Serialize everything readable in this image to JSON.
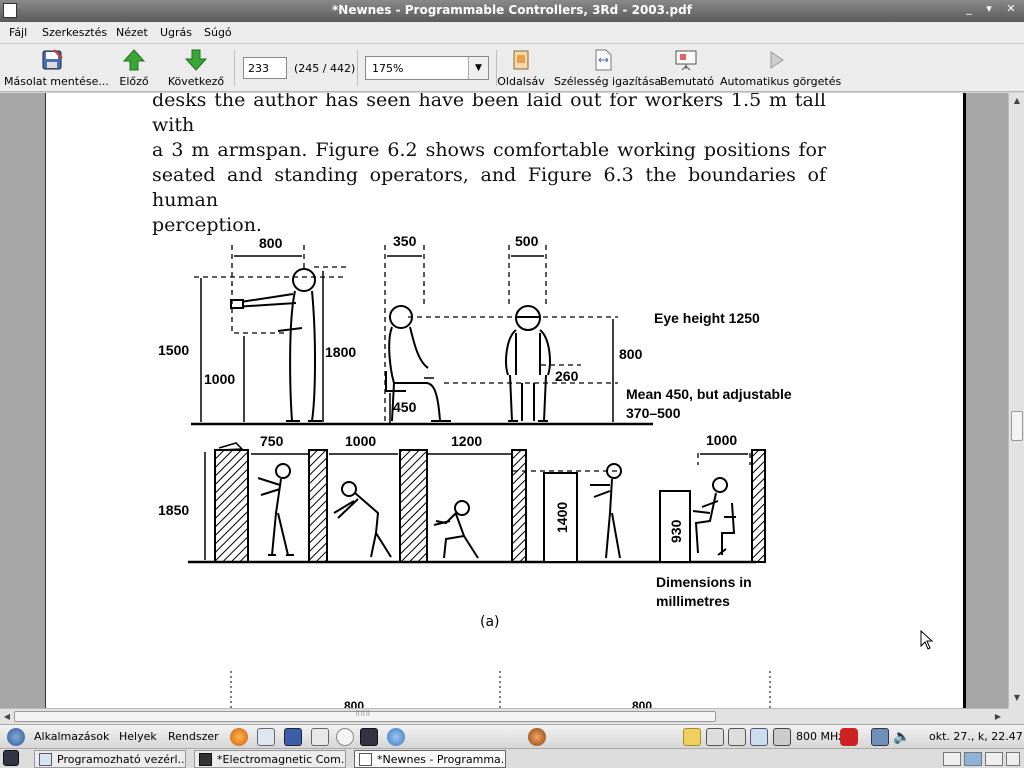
{
  "window": {
    "title": "*Newnes - Programmable Controllers, 3Rd - 2003.pdf",
    "controls": [
      "_",
      "▾",
      "✕"
    ]
  },
  "menu": [
    "Fájl",
    "Szerkesztés",
    "Nézet",
    "Ugrás",
    "Súgó"
  ],
  "toolbar": {
    "save_copy": "Másolat mentése...",
    "prev": "Előző",
    "next": "Következő",
    "page_value": "233",
    "page_count": "(245 / 442)",
    "zoom": "175%",
    "sidebar": "Oldalsáv",
    "fit_width": "Szélesség igazítása",
    "presentation": "Bemutató",
    "autoscroll": "Automatikus görgetés"
  },
  "document": {
    "lines": [
      "desks the author has seen have been laid out for workers 1.5 m tall with",
      "a 3 m armspan. Figure 6.2 shows comfortable working positions for",
      "seated and standing operators, and Figure 6.3 the boundaries of human",
      "perception."
    ],
    "figure_labels": {
      "w800": "800",
      "w350": "350",
      "w500": "500",
      "h1500": "1500",
      "h1000": "1000",
      "h1800": "1800",
      "eye_height": "Eye height 1250",
      "h800": "800",
      "h260": "260",
      "mean": "Mean 450, but adjustable",
      "range": "370–500",
      "h450": "450",
      "w750": "750",
      "w1000a": "1000",
      "w1200": "1200",
      "w1000b": "1000",
      "h1850": "1850",
      "h1400": "1400",
      "h930": "930",
      "dims1": "Dimensions in",
      "dims2": "millimetres",
      "next_a": "800",
      "next_b": "800"
    },
    "caption": "(a)"
  },
  "panel": {
    "menus": [
      "Alkalmazások",
      "Helyek",
      "Rendszer"
    ],
    "cpu": "800 MHz",
    "clock": "okt. 27., k, 22.47"
  },
  "taskbar": {
    "tasks": [
      "Programozható vezérl...",
      "*Electromagnetic Com...",
      "*Newnes - Programma..."
    ]
  },
  "colors": {
    "titlebar": "#6e6e6e",
    "viewport": "#a6a6a6",
    "arrow_green": "#3aa635",
    "power_red": "#cc2222"
  }
}
